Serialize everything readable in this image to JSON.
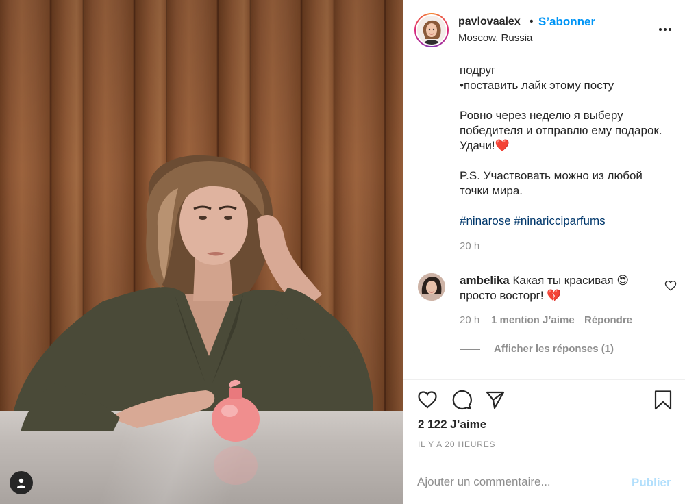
{
  "post": {
    "image_alt": "Woman in olive blazer holding a pink perfume bottle"
  },
  "header": {
    "username": "pavlovaalex",
    "separator": "•",
    "follow_label": "S’abonner",
    "location": "Moscow, Russia",
    "more_icon": "more-horizontal-icon"
  },
  "caption": {
    "lines": [
      "подруг",
      "•поставить лайк этому посту",
      "Ровно через неделю я выберу",
      "победителя и отправлю ему подарок.",
      "Удачи!❤️",
      "P.S. Участвовать можно из любой",
      "точки мира."
    ],
    "hashtags": [
      "#ninarose",
      "#ninaricciparfums"
    ],
    "time": "20 h"
  },
  "comment": {
    "username": "ambelika",
    "text_line1": "Какая ты красивая 😍",
    "text_line2": "просто восторг! 💔",
    "time": "20 h",
    "likes": "1 mention J’aime",
    "reply_label": "Répondre",
    "view_replies": "Afficher les réponses (1)"
  },
  "actions": {
    "like_icon": "heart-icon",
    "comment_icon": "comment-icon",
    "share_icon": "send-icon",
    "save_icon": "bookmark-icon",
    "likes_count": "2 122 J’aime",
    "posted_ago": "IL Y A 20 HEURES"
  },
  "add_comment": {
    "placeholder": "Ajouter un commentaire...",
    "publish_label": "Publier"
  },
  "colors": {
    "link": "#0095f6",
    "hashtag": "#00376b",
    "muted": "#8e8e8e",
    "publish_disabled": "#b2dffc"
  }
}
